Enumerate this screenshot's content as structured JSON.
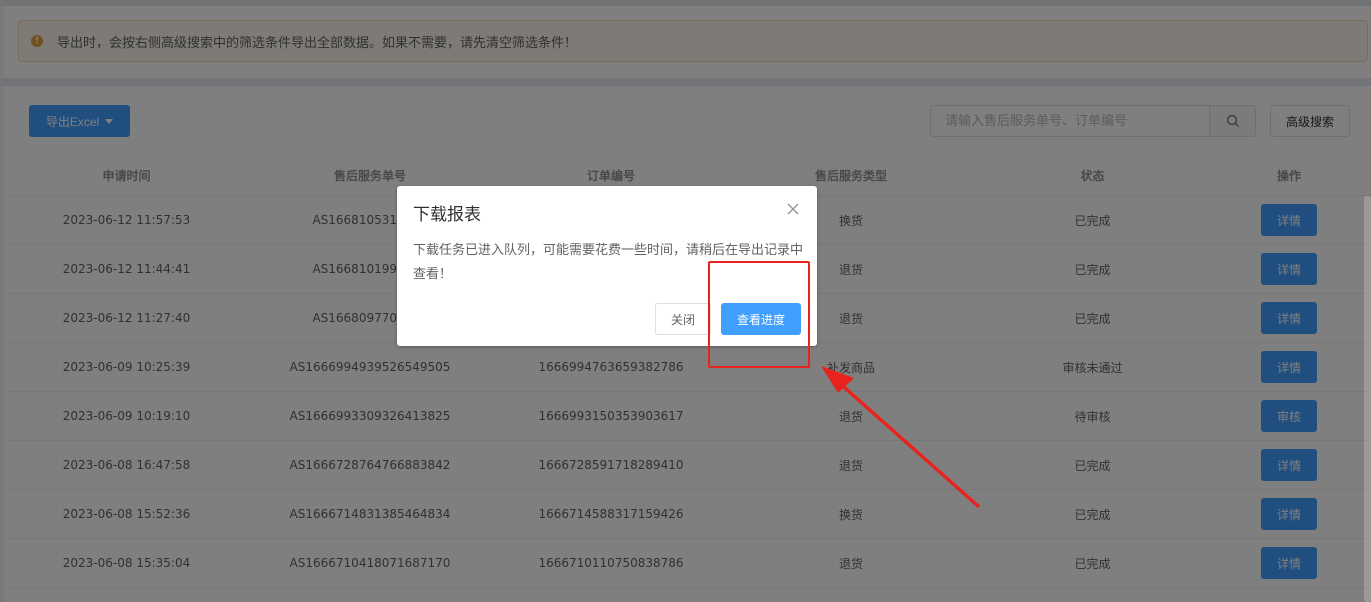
{
  "notice": {
    "icon": "warning-icon",
    "text": "导出时，会按右侧高级搜索中的筛选条件导出全部数据。如果不需要，请先清空筛选条件！"
  },
  "toolbar": {
    "export_label": "导出Excel",
    "search_placeholder": "请输入售后服务单号、订单编号",
    "search_value": "",
    "advanced_search_label": "高级搜索"
  },
  "table": {
    "columns": [
      "申请时间",
      "售后服务单号",
      "订单编号",
      "售后服务类型",
      "状态",
      "操作"
    ],
    "rows": [
      {
        "time": "2023-06-12 11:57:53",
        "service_no": "AS1668105315584",
        "order_no": "",
        "type": "换货",
        "status": "已完成",
        "action": "详情"
      },
      {
        "time": "2023-06-12 11:44:41",
        "service_no": "AS1668101992106",
        "order_no": "",
        "type": "退货",
        "status": "已完成",
        "action": "详情"
      },
      {
        "time": "2023-06-12 11:27:40",
        "service_no": "AS1668097708966",
        "order_no": "",
        "type": "退货",
        "status": "已完成",
        "action": "详情"
      },
      {
        "time": "2023-06-09 10:25:39",
        "service_no": "AS1666994939526549505",
        "order_no": "1666994763659382786",
        "type": "补发商品",
        "status": "审核未通过",
        "action": "详情"
      },
      {
        "time": "2023-06-09 10:19:10",
        "service_no": "AS1666993309326413825",
        "order_no": "1666993150353903617",
        "type": "退货",
        "status": "待审核",
        "action": "审核"
      },
      {
        "time": "2023-06-08 16:47:58",
        "service_no": "AS1666728764766883842",
        "order_no": "1666728591718289410",
        "type": "退货",
        "status": "已完成",
        "action": "详情"
      },
      {
        "time": "2023-06-08 15:52:36",
        "service_no": "AS1666714831385464834",
        "order_no": "1666714588317159426",
        "type": "换货",
        "status": "已完成",
        "action": "详情"
      },
      {
        "time": "2023-06-08 15:35:04",
        "service_no": "AS1666710418071687170",
        "order_no": "1666710110750838786",
        "type": "退货",
        "status": "已完成",
        "action": "详情"
      }
    ]
  },
  "dialog": {
    "title": "下载报表",
    "message": "下载任务已进入队列，可能需要花费一些时间，请稍后在导出记录中查看！",
    "cancel_label": "关闭",
    "confirm_label": "查看进度"
  },
  "colors": {
    "primary": "#409eff",
    "warning": "#e6a23c",
    "annotation": "#e8231e"
  }
}
